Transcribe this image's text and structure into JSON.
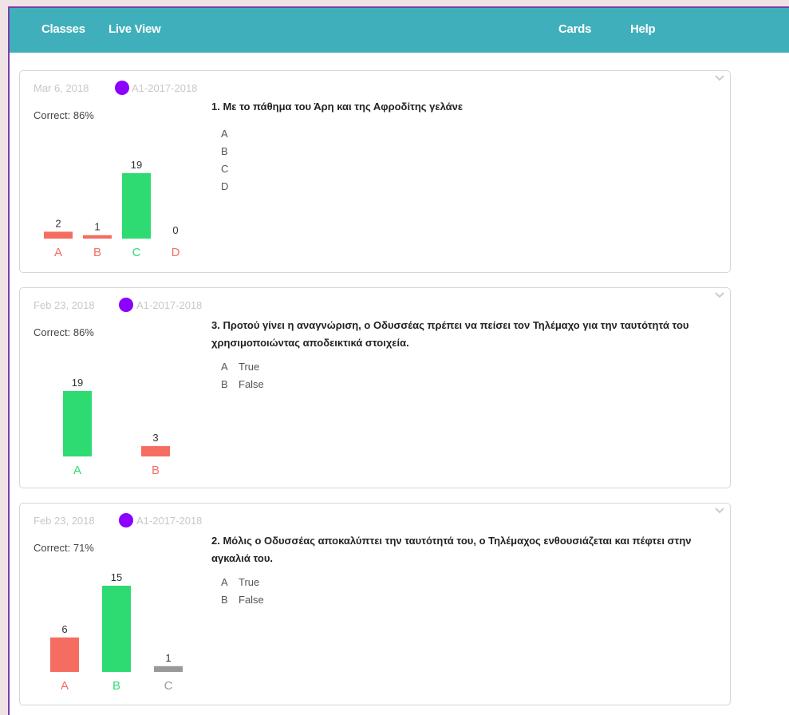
{
  "nav": {
    "classes": "Classes",
    "live_view": "Live View",
    "cards": "Cards",
    "help": "Help"
  },
  "colors": {
    "correct": "#2edb73",
    "incorrect": "#f56d60",
    "neutral": "#999999",
    "class_dot": "#8b00ff",
    "topbar": "#3fb0bb"
  },
  "icons": {
    "collapse": "chevron-down-icon",
    "class_marker": "circle-icon"
  },
  "cards": [
    {
      "date": "Mar 6, 2018",
      "class_name": "A1-2017-2018",
      "correct": "Correct: 86%",
      "question": "1. Με το πάθημα του Άρη και της Αφροδίτης γελάνε",
      "answers": [
        {
          "letter": "A",
          "text": ""
        },
        {
          "letter": "B",
          "text": ""
        },
        {
          "letter": "C",
          "text": ""
        },
        {
          "letter": "D",
          "text": ""
        }
      ],
      "chart_data": {
        "type": "bar",
        "categories": [
          "A",
          "B",
          "C",
          "D"
        ],
        "values": [
          2,
          1,
          19,
          0
        ],
        "status": [
          "incorrect",
          "incorrect",
          "correct",
          "incorrect"
        ],
        "ylim": [
          0,
          19
        ]
      }
    },
    {
      "date": "Feb 23, 2018",
      "class_name": "A1-2017-2018",
      "correct": "Correct: 86%",
      "question": "3. Προτού γίνει η αναγνώριση, ο Οδυσσέας πρέπει να πείσει τον Τηλέμαχο για την ταυτότητά του χρησιμοποιώντας αποδεικτικά στοιχεία.",
      "answers": [
        {
          "letter": "A",
          "text": "True"
        },
        {
          "letter": "B",
          "text": "False"
        }
      ],
      "chart_data": {
        "type": "bar",
        "categories": [
          "A",
          "B"
        ],
        "values": [
          19,
          3
        ],
        "status": [
          "correct",
          "incorrect"
        ],
        "ylim": [
          0,
          19
        ]
      }
    },
    {
      "date": "Feb 23, 2018",
      "class_name": "A1-2017-2018",
      "correct": "Correct: 71%",
      "question": "2. Μόλις ο Οδυσσέας αποκαλύπτει την ταυτότητά του, ο Τηλέμαχος ενθουσιάζεται και πέφτει στην αγκαλιά του.",
      "answers": [
        {
          "letter": "A",
          "text": "True"
        },
        {
          "letter": "B",
          "text": "False"
        }
      ],
      "chart_data": {
        "type": "bar",
        "categories": [
          "A",
          "B",
          "C"
        ],
        "values": [
          6,
          15,
          1
        ],
        "status": [
          "incorrect",
          "correct",
          "neutral"
        ],
        "ylim": [
          0,
          19
        ]
      }
    }
  ]
}
